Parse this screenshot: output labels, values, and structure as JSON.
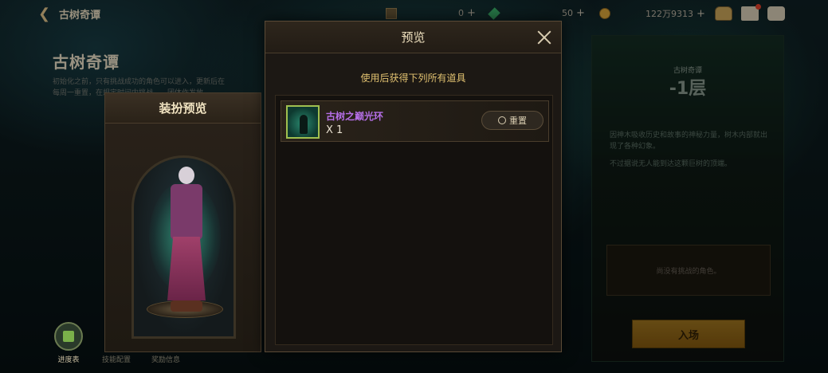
{
  "topbar": {
    "back_title": "古树奇谭",
    "resources": [
      {
        "name": "box-resource",
        "value": "0"
      },
      {
        "name": "gem-resource",
        "value": "50"
      },
      {
        "name": "gold-resource",
        "value": "122万9313"
      }
    ]
  },
  "page": {
    "title": "古树奇谭",
    "description": "初始化之前，只有挑战成功的角色可以进入，更新后在每周一重置，在规定时间内挑战……团体作发放。"
  },
  "outfit_panel": {
    "title": "装扮预览"
  },
  "bottom_nav": [
    {
      "label": "进度表"
    },
    {
      "label": "技能配置"
    },
    {
      "label": "奖励信息"
    }
  ],
  "modal": {
    "title": "预览",
    "subtitle": "使用后获得下列所有道具",
    "items": [
      {
        "name": "古树之巅光环",
        "quantity": "X 1",
        "action": "重置"
      }
    ]
  },
  "right_panel": {
    "floor_subtitle": "古树奇谭",
    "floor": "-1层",
    "description": "因神木吸收历史和故事的神秘力量，树木内部就出现了各种幻象。",
    "description2": "不过据说无人能到达这颗巨树的顶端。",
    "challenger_text": "尚没有挑战的角色。",
    "enter_label": "入场"
  }
}
